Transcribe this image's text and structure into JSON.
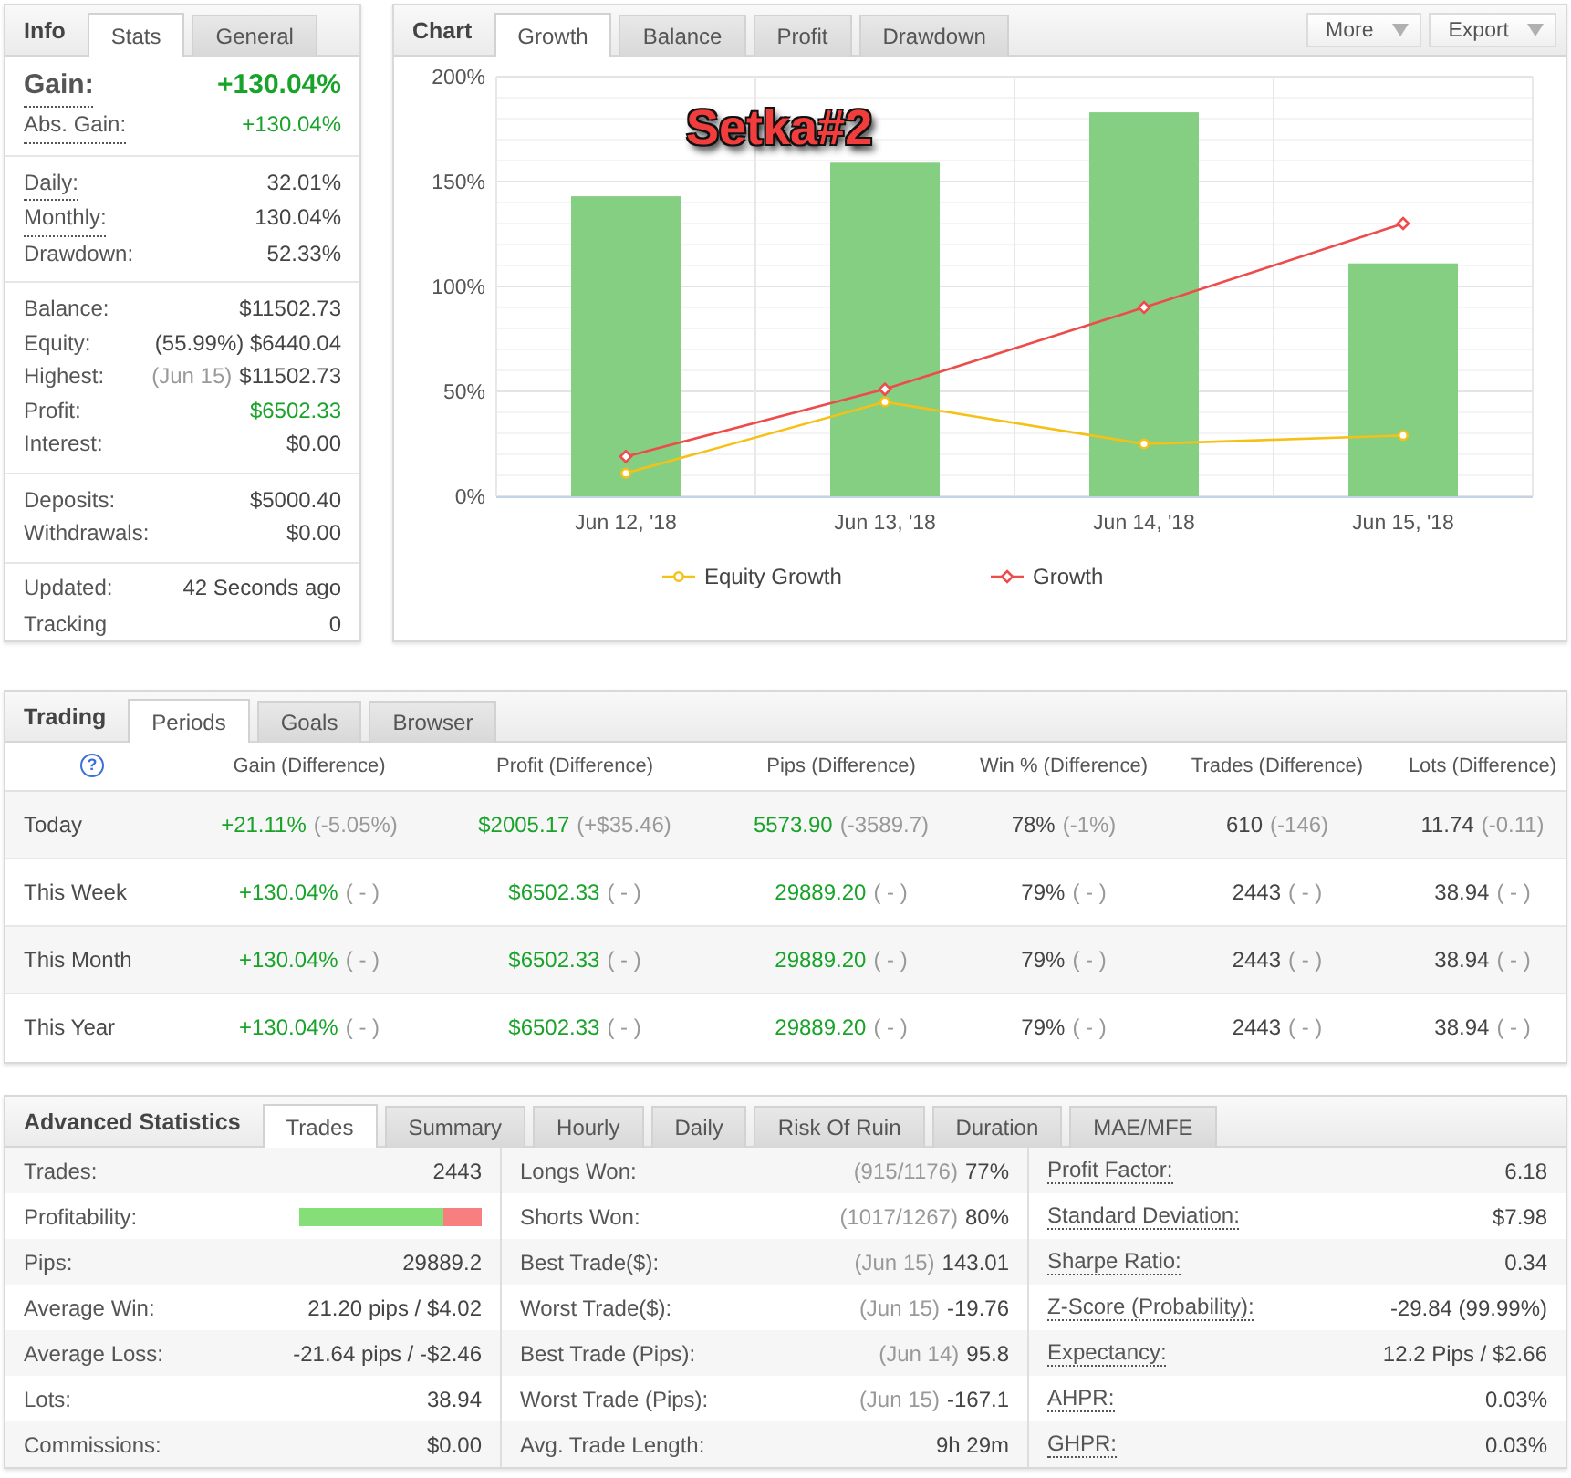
{
  "info": {
    "title": "Info",
    "tabs": [
      {
        "label": "Stats",
        "selected": true
      },
      {
        "label": "General",
        "selected": false
      }
    ],
    "groups": [
      {
        "rows": [
          {
            "kind": "headline",
            "label": "Gain:",
            "value": "+130.04%",
            "positive": true,
            "tooltip": true
          },
          {
            "kind": "normal",
            "label": "Abs. Gain:",
            "value": "+130.04%",
            "positive": true,
            "tooltip": true
          }
        ]
      },
      {
        "rows": [
          {
            "kind": "normal",
            "label": "Daily:",
            "value": "32.01%",
            "positive": false,
            "tooltip": true
          },
          {
            "kind": "normal",
            "label": "Monthly:",
            "value": "130.04%",
            "positive": false,
            "tooltip": true
          },
          {
            "kind": "normal",
            "label": "Drawdown:",
            "value": "52.33%",
            "positive": false,
            "tooltip": false
          }
        ]
      },
      {
        "rows": [
          {
            "kind": "normal",
            "label": "Balance:",
            "value": "$11502.73",
            "positive": false,
            "tooltip": false
          },
          {
            "kind": "normal",
            "label": "Equity:",
            "value": "(55.99%) $6440.04",
            "positive": false,
            "tooltip": false
          },
          {
            "kind": "normal",
            "label": "Highest:",
            "note": "(Jun 15)",
            "value": "$11502.73",
            "positive": false,
            "tooltip": false
          },
          {
            "kind": "normal",
            "label": "Profit:",
            "value": "$6502.33",
            "positive": true,
            "tooltip": false
          },
          {
            "kind": "normal",
            "label": "Interest:",
            "value": "$0.00",
            "positive": false,
            "tooltip": false
          }
        ]
      },
      {
        "rows": [
          {
            "kind": "normal",
            "label": "Deposits:",
            "value": "$5000.40",
            "positive": false,
            "tooltip": false
          },
          {
            "kind": "normal",
            "label": "Withdrawals:",
            "value": "$0.00",
            "positive": false,
            "tooltip": false
          }
        ]
      },
      {
        "rows": [
          {
            "kind": "normal",
            "label": "Updated:",
            "value": "42 Seconds ago",
            "positive": false,
            "tooltip": false
          },
          {
            "kind": "normal",
            "label": "Tracking",
            "value": "0",
            "positive": false,
            "tooltip": false
          }
        ]
      }
    ]
  },
  "chart_panel": {
    "title": "Chart",
    "tabs": [
      {
        "label": "Growth",
        "selected": true
      },
      {
        "label": "Balance",
        "selected": false
      },
      {
        "label": "Profit",
        "selected": false
      },
      {
        "label": "Drawdown",
        "selected": false
      }
    ],
    "actions": [
      "More",
      "Export"
    ],
    "chart_data": {
      "type": "bar",
      "categories": [
        "Jun 12, '18",
        "Jun 13, '18",
        "Jun 14, '18",
        "Jun 15, '18"
      ],
      "ylim": [
        0,
        200
      ],
      "yticks": [
        {
          "value": 0,
          "label": "0%"
        },
        {
          "value": 50,
          "label": "50%"
        },
        {
          "value": 100,
          "label": "100%"
        },
        {
          "value": 150,
          "label": "150%"
        },
        {
          "value": 200,
          "label": "200%"
        }
      ],
      "grid": true,
      "legend": "bottom",
      "series": [
        {
          "type": "bar",
          "color": "#85cf82",
          "values": [
            143,
            159,
            183,
            111
          ]
        },
        {
          "type": "line",
          "name": "Equity Growth",
          "marker": "circle",
          "color": "#f5c116",
          "values": [
            11,
            45,
            25,
            29
          ]
        },
        {
          "type": "line",
          "name": "Growth",
          "marker": "diamond",
          "color": "#ee4b4b",
          "values": [
            19,
            51,
            90,
            130
          ]
        }
      ],
      "annotations": [
        {
          "text": "Setka#2"
        }
      ]
    }
  },
  "trading": {
    "title": "Trading",
    "tabs": [
      {
        "label": "Periods",
        "selected": true
      },
      {
        "label": "Goals",
        "selected": false
      },
      {
        "label": "Browser",
        "selected": false
      }
    ],
    "help_symbol": "?",
    "columns": [
      "Gain (Difference)",
      "Profit (Difference)",
      "Pips (Difference)",
      "Win % (Difference)",
      "Trades (Difference)",
      "Lots (Difference)"
    ],
    "rows": [
      {
        "period": "Today",
        "cells": [
          {
            "value": "+21.11%",
            "diff": "(-5.05%)",
            "positive": true
          },
          {
            "value": "$2005.17",
            "diff": "(+$35.46)",
            "positive": true
          },
          {
            "value": "5573.90",
            "diff": "(-3589.7)",
            "positive": true
          },
          {
            "value": "78%",
            "diff": "(-1%)",
            "positive": false
          },
          {
            "value": "610",
            "diff": "(-146)",
            "positive": false
          },
          {
            "value": "11.74",
            "diff": "(-0.11)",
            "positive": false
          }
        ]
      },
      {
        "period": "This Week",
        "cells": [
          {
            "value": "+130.04%",
            "diff": "( - )",
            "positive": true
          },
          {
            "value": "$6502.33",
            "diff": "( - )",
            "positive": true
          },
          {
            "value": "29889.20",
            "diff": "( - )",
            "positive": true
          },
          {
            "value": "79%",
            "diff": "( - )",
            "positive": false
          },
          {
            "value": "2443",
            "diff": "( - )",
            "positive": false
          },
          {
            "value": "38.94",
            "diff": "( - )",
            "positive": false
          }
        ]
      },
      {
        "period": "This Month",
        "cells": [
          {
            "value": "+130.04%",
            "diff": "( - )",
            "positive": true
          },
          {
            "value": "$6502.33",
            "diff": "( - )",
            "positive": true
          },
          {
            "value": "29889.20",
            "diff": "( - )",
            "positive": true
          },
          {
            "value": "79%",
            "diff": "( - )",
            "positive": false
          },
          {
            "value": "2443",
            "diff": "( - )",
            "positive": false
          },
          {
            "value": "38.94",
            "diff": "( - )",
            "positive": false
          }
        ]
      },
      {
        "period": "This Year",
        "cells": [
          {
            "value": "+130.04%",
            "diff": "( - )",
            "positive": true
          },
          {
            "value": "$6502.33",
            "diff": "( - )",
            "positive": true
          },
          {
            "value": "29889.20",
            "diff": "( - )",
            "positive": true
          },
          {
            "value": "79%",
            "diff": "( - )",
            "positive": false
          },
          {
            "value": "2443",
            "diff": "( - )",
            "positive": false
          },
          {
            "value": "38.94",
            "diff": "( - )",
            "positive": false
          }
        ]
      }
    ]
  },
  "advanced": {
    "title": "Advanced Statistics",
    "tabs": [
      {
        "label": "Trades",
        "selected": true
      },
      {
        "label": "Summary",
        "selected": false
      },
      {
        "label": "Hourly",
        "selected": false
      },
      {
        "label": "Daily",
        "selected": false
      },
      {
        "label": "Risk Of Ruin",
        "selected": false
      },
      {
        "label": "Duration",
        "selected": false
      },
      {
        "label": "MAE/MFE",
        "selected": false
      }
    ],
    "columns": [
      {
        "rows": [
          {
            "kind": "text",
            "label": "Trades:",
            "value": "2443",
            "tooltip": false
          },
          {
            "kind": "bar",
            "label": "Profitability:",
            "level": 0.79,
            "tooltip": false
          },
          {
            "kind": "text",
            "label": "Pips:",
            "value": "29889.2",
            "tooltip": false
          },
          {
            "kind": "text",
            "label": "Average Win:",
            "value": "21.20 pips / $4.02",
            "tooltip": false
          },
          {
            "kind": "text",
            "label": "Average Loss:",
            "value": "-21.64 pips / -$2.46",
            "tooltip": false
          },
          {
            "kind": "text",
            "label": "Lots:",
            "value": "38.94",
            "tooltip": false
          },
          {
            "kind": "text",
            "label": "Commissions:",
            "value": "$0.00",
            "tooltip": false
          }
        ]
      },
      {
        "rows": [
          {
            "kind": "text",
            "label": "Longs Won:",
            "note": "(915/1176)",
            "value": "77%",
            "tooltip": false
          },
          {
            "kind": "text",
            "label": "Shorts Won:",
            "note": "(1017/1267)",
            "value": "80%",
            "tooltip": false
          },
          {
            "kind": "text",
            "label": "Best Trade($):",
            "note": "(Jun 15)",
            "value": "143.01",
            "tooltip": false
          },
          {
            "kind": "text",
            "label": "Worst Trade($):",
            "note": "(Jun 15)",
            "value": "-19.76",
            "tooltip": false
          },
          {
            "kind": "text",
            "label": "Best Trade (Pips):",
            "note": "(Jun 14)",
            "value": "95.8",
            "tooltip": false
          },
          {
            "kind": "text",
            "label": "Worst Trade (Pips):",
            "note": "(Jun 15)",
            "value": "-167.1",
            "tooltip": false
          },
          {
            "kind": "text",
            "label": "Avg. Trade Length:",
            "value": "9h 29m",
            "tooltip": false
          }
        ]
      },
      {
        "rows": [
          {
            "kind": "text",
            "label": "Profit Factor:",
            "value": "6.18",
            "tooltip": true
          },
          {
            "kind": "text",
            "label": "Standard Deviation:",
            "value": "$7.98",
            "tooltip": true
          },
          {
            "kind": "text",
            "label": "Sharpe Ratio:",
            "value": "0.34",
            "tooltip": true
          },
          {
            "kind": "text",
            "label": "Z-Score (Probability):",
            "value": "-29.84 (99.99%)",
            "tooltip": true
          },
          {
            "kind": "text",
            "label": "Expectancy:",
            "value": "12.2 Pips / $2.66",
            "tooltip": true
          },
          {
            "kind": "text",
            "label": "AHPR:",
            "value": "0.03%",
            "tooltip": true
          },
          {
            "kind": "text",
            "label": "GHPR:",
            "value": "0.03%",
            "tooltip": true
          }
        ]
      }
    ]
  }
}
